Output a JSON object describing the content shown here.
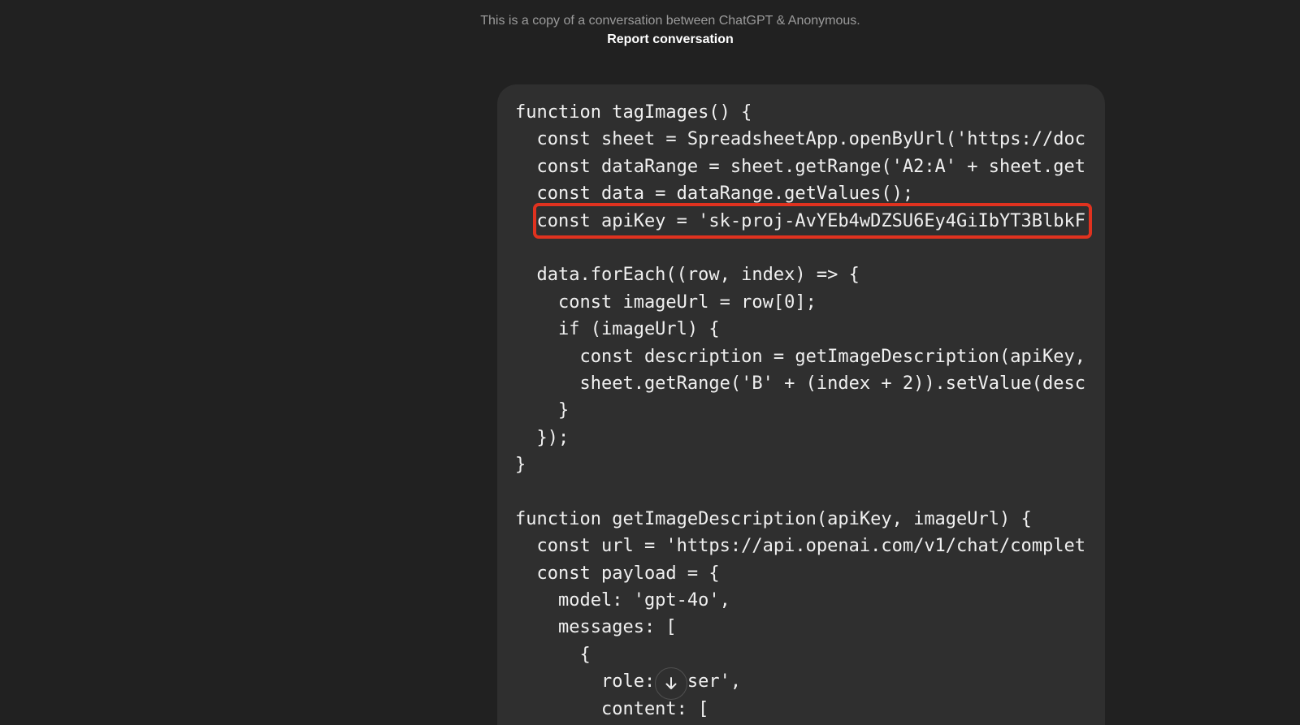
{
  "header": {
    "notice": "This is a copy of a conversation between ChatGPT & Anonymous.",
    "report_label": "Report conversation"
  },
  "code": {
    "lines": [
      "function tagImages() {",
      "  const sheet = SpreadsheetApp.openByUrl('https://doc",
      "  const dataRange = sheet.getRange('A2:A' + sheet.get",
      "  const data = dataRange.getValues();",
      "  const apiKey = 'sk-proj-AvYEb4wDZSU6Ey4GiIbYT3BlbkF",
      "",
      "  data.forEach((row, index) => {",
      "    const imageUrl = row[0];",
      "    if (imageUrl) {",
      "      const description = getImageDescription(apiKey,",
      "      sheet.getRange('B' + (index + 2)).setValue(desc",
      "    }",
      "  });",
      "}",
      "",
      "function getImageDescription(apiKey, imageUrl) {",
      "  const url = 'https://api.openai.com/v1/chat/complet",
      "  const payload = {",
      "    model: 'gpt-4o',",
      "    messages: [",
      "      {",
      "        role: 'user',",
      "        content: ["
    ],
    "highlighted_line": 4
  },
  "colors": {
    "background": "#212121",
    "bubble": "#2f2f2f",
    "highlight": "#e0321f"
  },
  "icons": {
    "scroll_down": "arrow-down-icon"
  }
}
